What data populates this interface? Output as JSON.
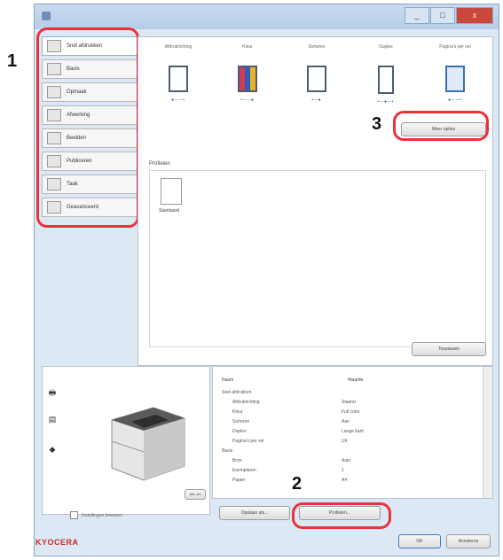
{
  "window": {
    "close_label": "x",
    "min_label": "_",
    "max_label": "□"
  },
  "sidebar": {
    "items": [
      {
        "label": "Snel afdrukken",
        "icon": "quick-print-icon"
      },
      {
        "label": "Basis",
        "icon": "basic-icon"
      },
      {
        "label": "Opmaak",
        "icon": "layout-icon"
      },
      {
        "label": "Afwerking",
        "icon": "finishing-icon"
      },
      {
        "label": "Beelden",
        "icon": "imaging-icon"
      },
      {
        "label": "Publiceren",
        "icon": "publishing-icon"
      },
      {
        "label": "Taak",
        "icon": "job-icon"
      },
      {
        "label": "Geavanceerd",
        "icon": "advanced-icon"
      }
    ]
  },
  "options": {
    "columns": [
      {
        "title": "Afdrukrichting",
        "icon": "orientation-icon"
      },
      {
        "title": "Kleur",
        "icon": "color-icon"
      },
      {
        "title": "Sorteren",
        "icon": "collate-icon"
      },
      {
        "title": "Duplex",
        "icon": "duplex-icon"
      },
      {
        "title": "Pagina's per vel",
        "icon": "pages-per-sheet-icon"
      }
    ],
    "more_button": "Meer opties"
  },
  "favorites": {
    "label": "Profielen",
    "item_label": "Standaard",
    "apply_button": "Toepassen"
  },
  "summary": {
    "col_name": "Naam",
    "col_value": "Waarde",
    "rows": [
      {
        "name": "Snel afdrukken",
        "value": "",
        "indent": 0
      },
      {
        "name": "Afdrukrichting",
        "value": "Staand",
        "indent": 1
      },
      {
        "name": "Kleur",
        "value": "Full color",
        "indent": 1
      },
      {
        "name": "Sorteren",
        "value": "Aan",
        "indent": 1
      },
      {
        "name": "Duplex",
        "value": "Lange kant",
        "indent": 1
      },
      {
        "name": "Pagina's per vel",
        "value": "Uit",
        "indent": 1
      },
      {
        "name": "Basis",
        "value": "",
        "indent": 0
      },
      {
        "name": "Bron",
        "value": "Auto",
        "indent": 1
      },
      {
        "name": "Exemplaren",
        "value": "1",
        "indent": 1
      },
      {
        "name": "Papier",
        "value": "A4",
        "indent": 1
      }
    ]
  },
  "preview": {
    "mode_label": "Afb. A4"
  },
  "footer": {
    "checkbox_label": "Instellingen bewaren",
    "save_profile": "Opslaan als...",
    "preferences": "Profielen...",
    "ok": "OK",
    "cancel": "Annuleren",
    "brand": "KYOCERA"
  },
  "callouts": {
    "one": "1",
    "two": "2",
    "three": "3"
  },
  "colors": {
    "highlight": "#e8333a",
    "brand": "#cc2b2b"
  }
}
